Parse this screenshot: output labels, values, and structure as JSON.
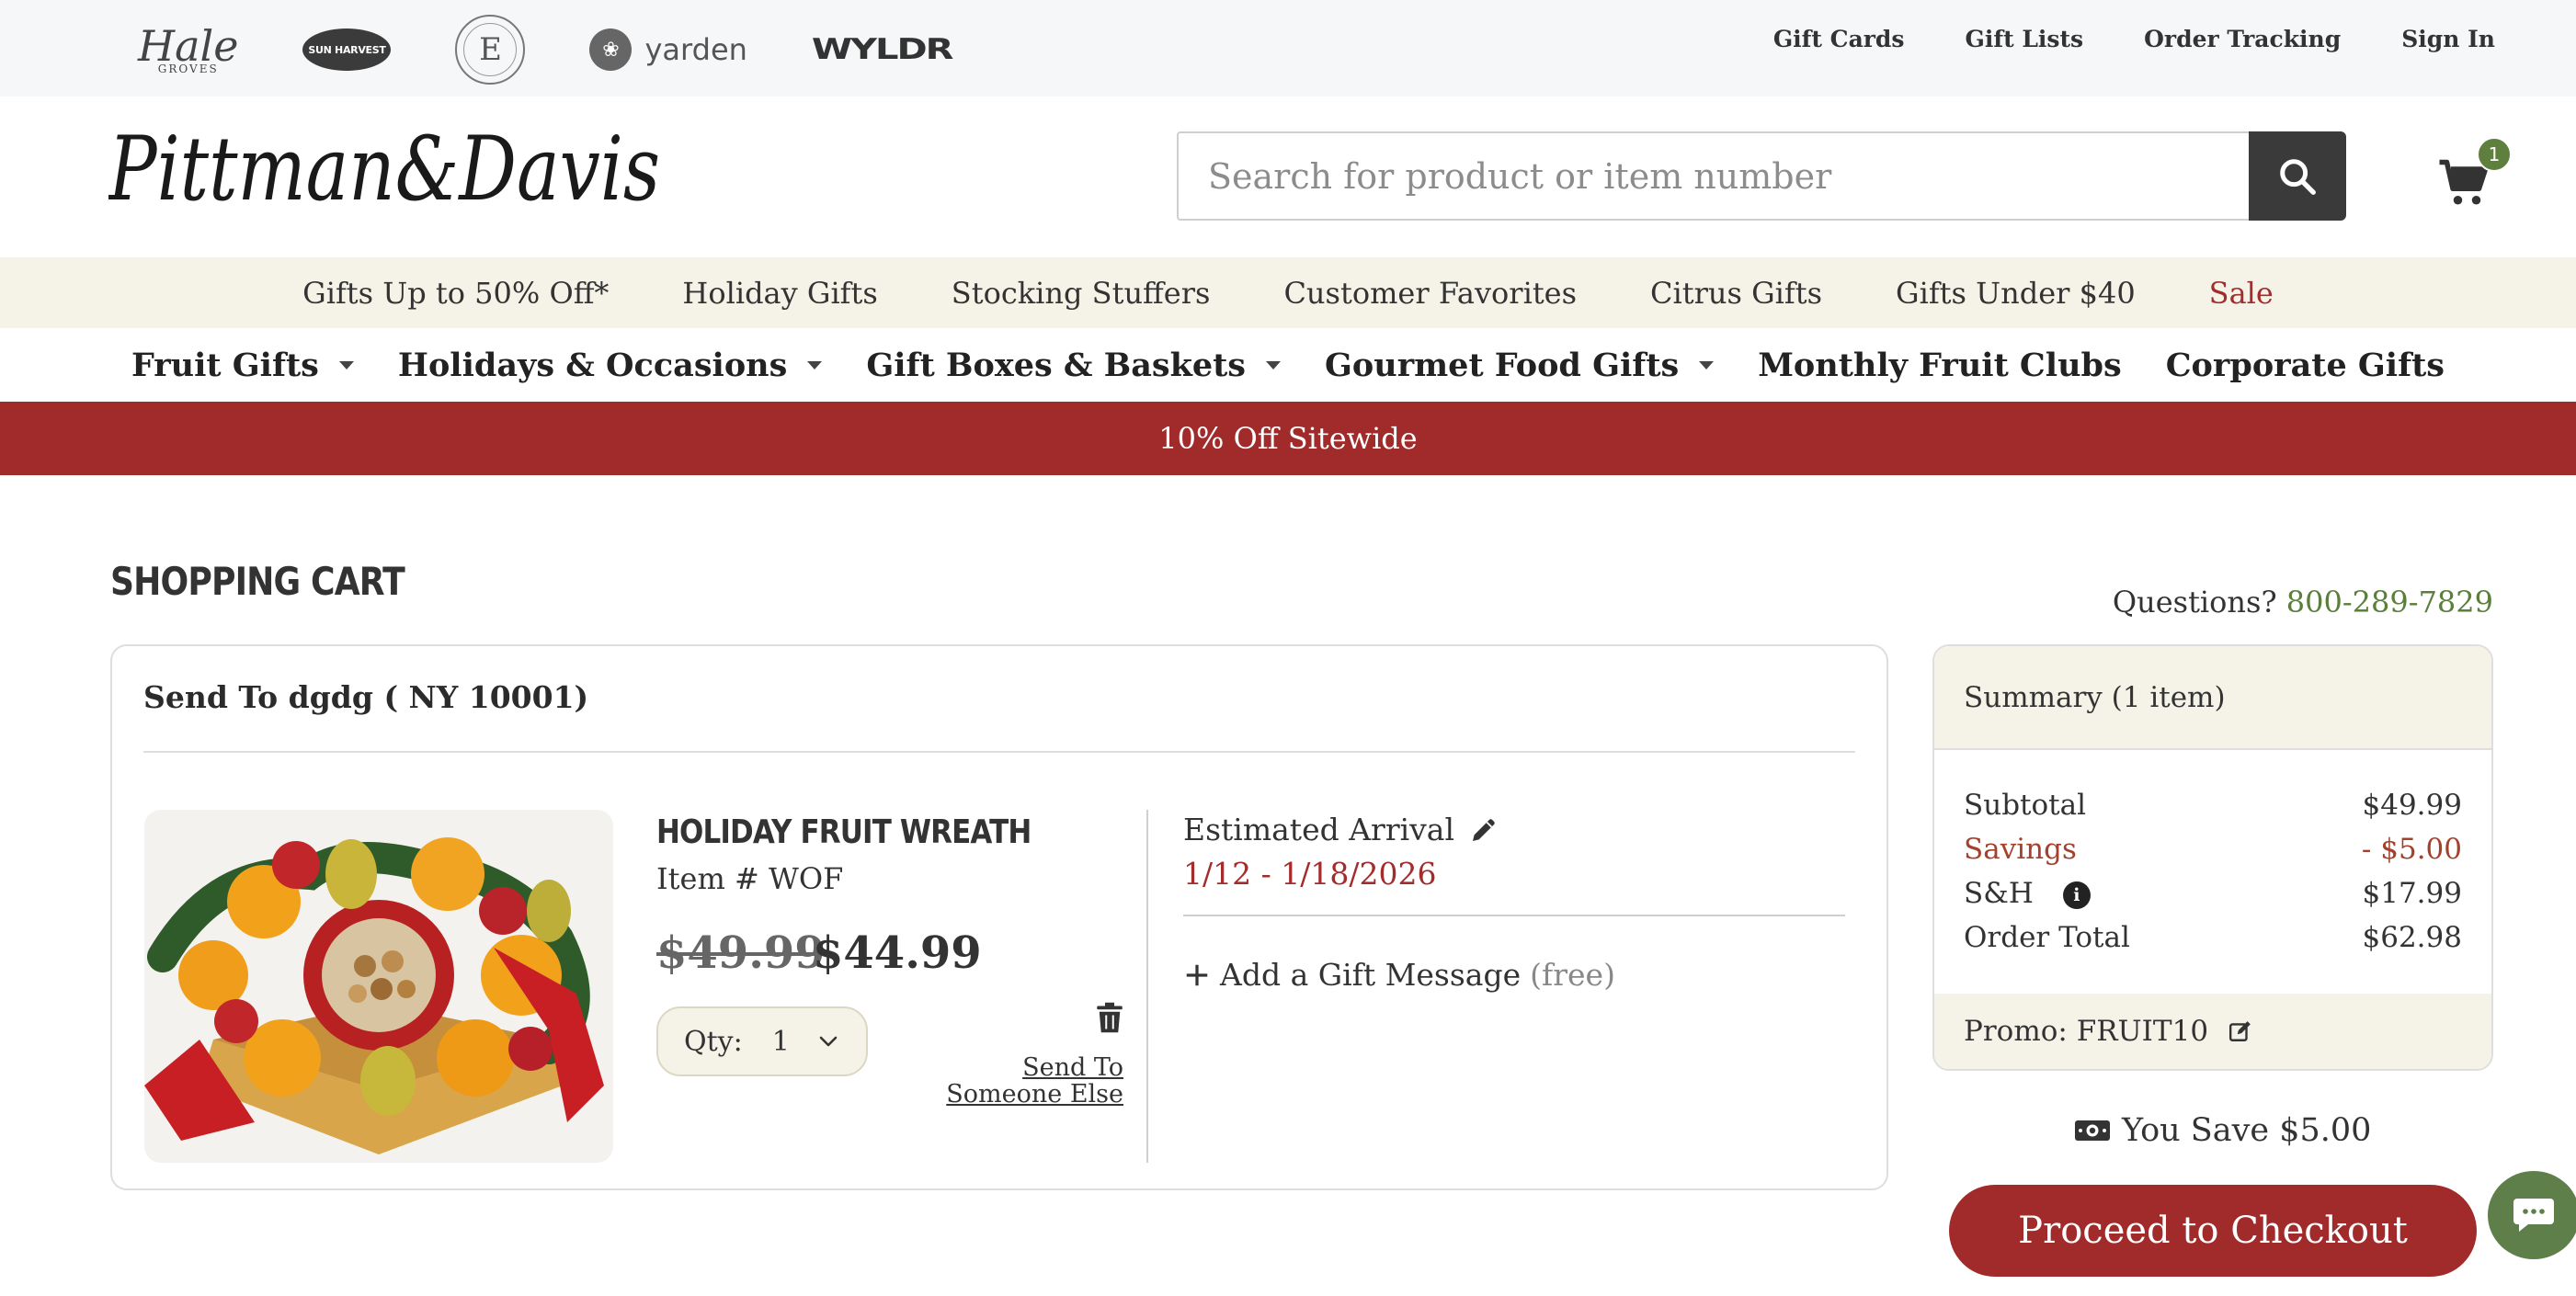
{
  "brands": {
    "hale": "Hale",
    "hale_sub": "GROVES",
    "sun_harvest": "SUN HARVEST",
    "everglades": "E",
    "yarden": "yarden",
    "wyldr": "WYLDR"
  },
  "utility_links": [
    "Gift Cards",
    "Gift Lists",
    "Order Tracking",
    "Sign In"
  ],
  "logo_text": "Pittman&Davis",
  "search": {
    "placeholder": "Search for product or item number"
  },
  "cart": {
    "count": "1"
  },
  "promo_nav": [
    "Gifts Up to 50% Off*",
    "Holiday Gifts",
    "Stocking Stuffers",
    "Customer Favorites",
    "Citrus Gifts",
    "Gifts Under $40",
    "Sale"
  ],
  "main_nav": [
    "Fruit Gifts",
    "Holidays & Occasions",
    "Gift Boxes & Baskets",
    "Gourmet Food Gifts",
    "Monthly Fruit Clubs",
    "Corporate Gifts"
  ],
  "banner": "10% Off Sitewide",
  "page": {
    "title": "SHOPPING CART",
    "questions_label": "Questions?",
    "phone": "800-289-7829"
  },
  "shipment": {
    "send_to": "Send To dgdg ( NY 10001)",
    "product_name": "HOLIDAY FRUIT WREATH",
    "item_number": "Item # WOF",
    "price_old": "$49.99",
    "price_new": "$44.99",
    "qty_label": "Qty:",
    "qty_value": "1",
    "send_else": "Send To Someone Else",
    "est_label": "Estimated Arrival",
    "est_date": "1/12 - 1/18/2026",
    "gift_msg": "Add a Gift Message",
    "gift_free": "(free)"
  },
  "summary": {
    "title": "Summary (1 item)",
    "subtotal_label": "Subtotal",
    "subtotal": "$49.99",
    "savings_label": "Savings",
    "savings": "- $5.00",
    "sh_label": "S&H",
    "sh": "$17.99",
    "total_label": "Order Total",
    "total": "$62.98",
    "promo": "Promo: FRUIT10"
  },
  "you_save": "You Save $5.00",
  "checkout_label": "Proceed to Checkout",
  "colors": {
    "accent_red": "#a12b2b",
    "accent_green": "#5a7f3b",
    "cream": "#f5f3e8"
  }
}
